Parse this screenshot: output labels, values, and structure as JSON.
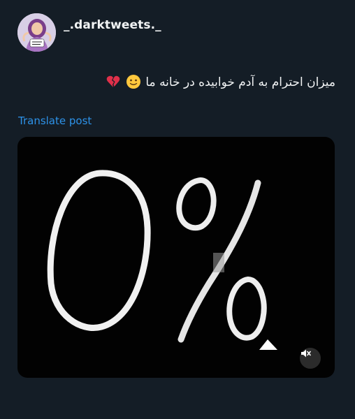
{
  "post": {
    "username": "_.darktweets._",
    "avatar_badge_text": "dark tweets",
    "text": "میزان احترام به آدم خوابیده در خانه ما",
    "emojis": [
      "slightly-smiling-face",
      "broken-heart"
    ],
    "translate_label": "Translate post"
  },
  "media": {
    "image_text": "0%",
    "mute_icon": "speaker-muted-icon"
  }
}
